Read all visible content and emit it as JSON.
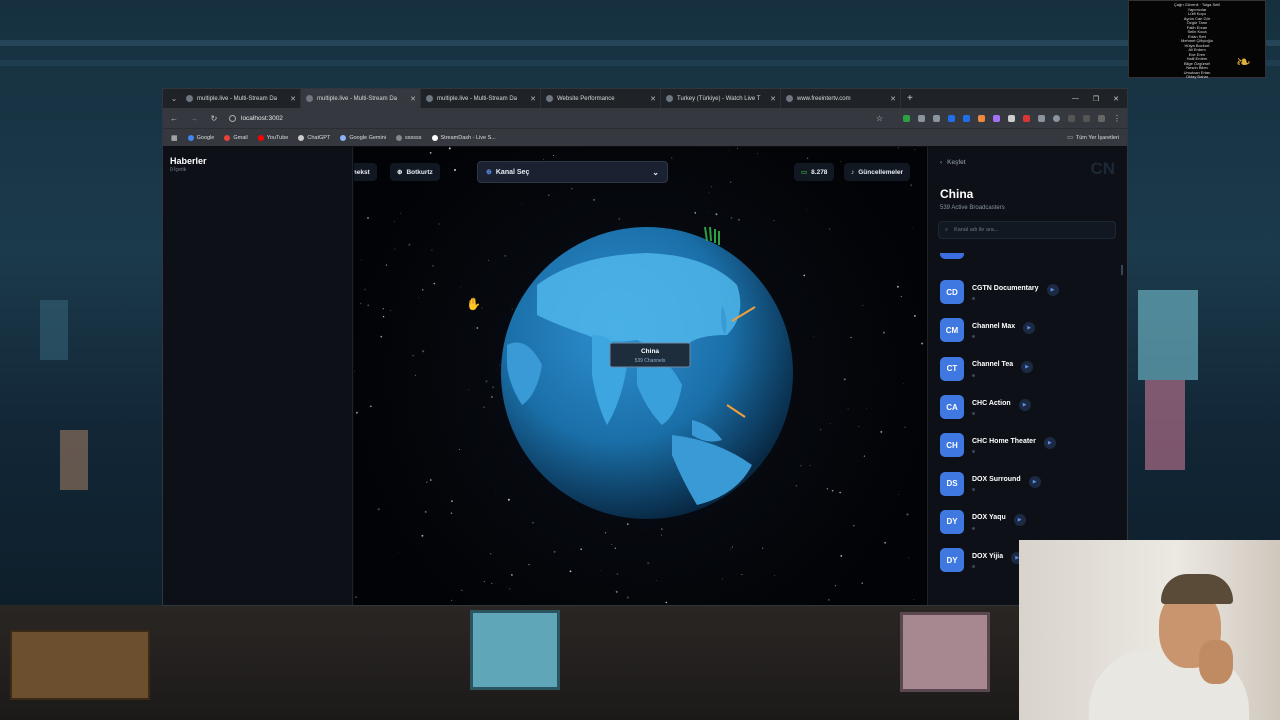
{
  "credits": {
    "lines": [
      "Çağrı Güvenli · Tolga Selil",
      "Yapımcılar",
      "Lütfi Koçu",
      "Aydın Can Gür",
      "Özgür Tanrı",
      "Fatih Ercan",
      "Selin Koca",
      "Ertan Sert",
      "Mehmet Çiftçioğlu",
      "Hülya Bozkurt",
      "Ali Erdem",
      "Ece Eren",
      "Halil Erdem",
      "Bilge Özgürsel",
      "Nesrin Bilen",
      "Umutcan Ertan",
      "Oktay Bahar"
    ]
  },
  "browser": {
    "tabs": [
      {
        "label": "multiple.live - Multi-Stream Da",
        "active": false
      },
      {
        "label": "multiple.live - Multi-Stream Da",
        "active": true
      },
      {
        "label": "multiple.live - Multi-Stream Da",
        "active": false
      },
      {
        "label": "Website Performance",
        "active": false
      },
      {
        "label": "Turkey (Türkiye) - Watch Live T",
        "active": false
      },
      {
        "label": "www.freeintertv.com",
        "active": false
      }
    ],
    "url": "localhost:3002",
    "bookmarks": [
      {
        "label": "Google",
        "color": "#4285f4"
      },
      {
        "label": "Gmail",
        "color": "#ea4335"
      },
      {
        "label": "YouTube",
        "color": "#ff0000"
      },
      {
        "label": "ChatGPT",
        "color": "#cccccc"
      },
      {
        "label": "Google Gemini",
        "color": "#8ab4f8"
      },
      {
        "label": "ssssss",
        "color": "#888888"
      },
      {
        "label": "StreamDash - Live S...",
        "color": "#ffffff"
      }
    ],
    "bookmarks_right": "Tüm Yer İşaretleri"
  },
  "news": {
    "title": "Haberler",
    "count": "0 İçerik"
  },
  "toolbar": {
    "left1": "inekst",
    "left2": "Botkurtz",
    "select_label": "Kanal Seç",
    "viewer_count": "8.278",
    "updates": "Güncellemeler"
  },
  "globe": {
    "tooltip_title": "China",
    "tooltip_sub": "539 Channels"
  },
  "country": {
    "back": "Keşfet",
    "code": "CN",
    "name": "China",
    "subtitle": "539 Active Broadcasters",
    "search_placeholder": "Kanal adı ile ara..."
  },
  "channels": [
    {
      "abbr": "CD",
      "name": "CGTN Documentary"
    },
    {
      "abbr": "CM",
      "name": "Channel Max"
    },
    {
      "abbr": "CT",
      "name": "Channel Tea"
    },
    {
      "abbr": "CA",
      "name": "CHC Action"
    },
    {
      "abbr": "CH",
      "name": "CHC Home Theater"
    },
    {
      "abbr": "DS",
      "name": "DOX Surround"
    },
    {
      "abbr": "DY",
      "name": "DOX Yaqu"
    },
    {
      "abbr": "DY",
      "name": "DOX Yijia"
    }
  ],
  "colors": {
    "accent": "#3f78e0",
    "ocean": "#1a6fa8",
    "land": "#2b8fd0"
  }
}
